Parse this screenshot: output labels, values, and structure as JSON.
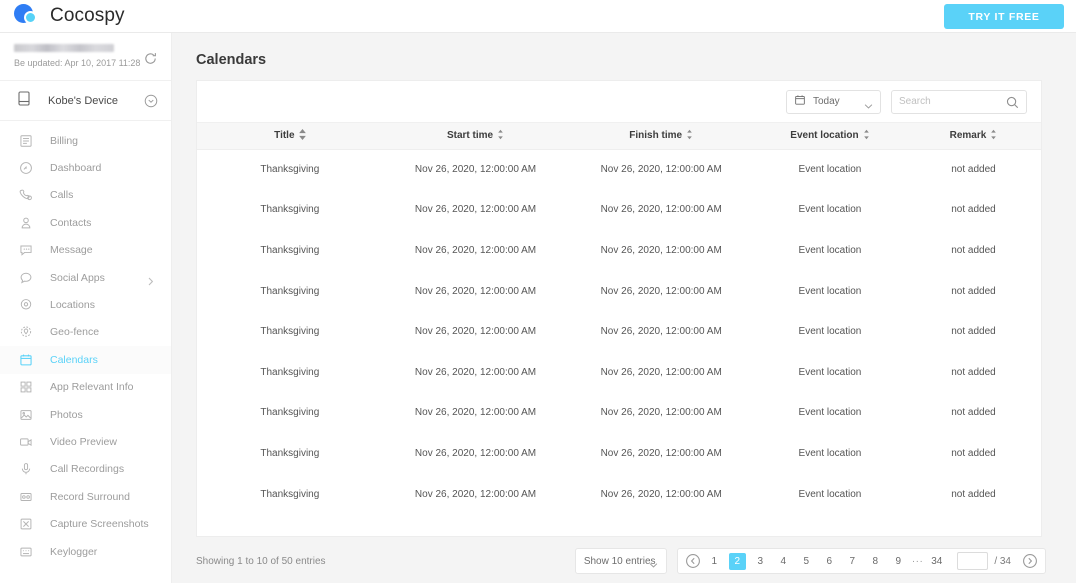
{
  "topbar": {
    "brand_name": "Cocospy",
    "logo_icon": "cocospy-logo",
    "cta_label": "TRY IT FREE",
    "cta_color": "#5ad2f8"
  },
  "sidebar": {
    "account": {
      "email_redacted": "",
      "updated_text": "Be updated: Apr 10, 2017 11:28",
      "refresh_icon": "refresh-icon"
    },
    "device": {
      "icon": "phone-icon",
      "name": "Kobe's Device",
      "caret_icon": "chevron-down-circle-icon"
    },
    "items": [
      {
        "label": "Billing",
        "icon": "billing-icon",
        "active": false
      },
      {
        "label": "Dashboard",
        "icon": "dashboard-icon",
        "active": false
      },
      {
        "label": "Calls",
        "icon": "phone-call-icon",
        "active": false
      },
      {
        "label": "Contacts",
        "icon": "contacts-icon",
        "active": false
      },
      {
        "label": "Message",
        "icon": "message-icon",
        "active": false
      },
      {
        "label": "Social Apps",
        "icon": "social-apps-icon",
        "active": false,
        "expandable": true
      },
      {
        "label": "Locations",
        "icon": "location-pin-icon",
        "active": false
      },
      {
        "label": "Geo-fence",
        "icon": "geofence-icon",
        "active": false
      },
      {
        "label": "Calendars",
        "icon": "calendar-icon",
        "active": true
      },
      {
        "label": "App Relevant Info",
        "icon": "app-grid-icon",
        "active": false
      },
      {
        "label": "Photos",
        "icon": "photo-icon",
        "active": false
      },
      {
        "label": "Video Preview",
        "icon": "video-camera-icon",
        "active": false
      },
      {
        "label": "Call Recordings",
        "icon": "microphone-icon",
        "active": false
      },
      {
        "label": "Record Surround",
        "icon": "record-surround-icon",
        "active": false
      },
      {
        "label": "Capture Screenshots",
        "icon": "screenshot-icon",
        "active": false
      },
      {
        "label": "Keylogger",
        "icon": "keyboard-icon",
        "active": false
      }
    ]
  },
  "main": {
    "page_title": "Calendars",
    "toolbar": {
      "date_filter_label": "Today",
      "date_filter_icon": "calendar-icon",
      "search_placeholder": "Search",
      "search_value": "",
      "search_icon": "search-icon"
    },
    "table": {
      "columns": [
        {
          "label": "Title",
          "sort_icon": "sort-icon"
        },
        {
          "label": "Start time",
          "sort_icon": "sort-icon"
        },
        {
          "label": "Finish time",
          "sort_icon": "sort-icon"
        },
        {
          "label": "Event location",
          "sort_icon": "sort-icon"
        },
        {
          "label": "Remark",
          "sort_icon": "sort-icon"
        }
      ],
      "rows": [
        {
          "title": "Thanksgiving",
          "start": "Nov 26, 2020, 12:00:00 AM",
          "finish": "Nov 26, 2020, 12:00:00 AM",
          "location": "Event location",
          "remark": "not added"
        },
        {
          "title": "Thanksgiving",
          "start": "Nov 26, 2020, 12:00:00 AM",
          "finish": "Nov 26, 2020, 12:00:00 AM",
          "location": "Event location",
          "remark": "not added"
        },
        {
          "title": "Thanksgiving",
          "start": "Nov 26, 2020, 12:00:00 AM",
          "finish": "Nov 26, 2020, 12:00:00 AM",
          "location": "Event location",
          "remark": "not added"
        },
        {
          "title": "Thanksgiving",
          "start": "Nov 26, 2020, 12:00:00 AM",
          "finish": "Nov 26, 2020, 12:00:00 AM",
          "location": "Event location",
          "remark": "not added"
        },
        {
          "title": "Thanksgiving",
          "start": "Nov 26, 2020, 12:00:00 AM",
          "finish": "Nov 26, 2020, 12:00:00 AM",
          "location": "Event location",
          "remark": "not added"
        },
        {
          "title": "Thanksgiving",
          "start": "Nov 26, 2020, 12:00:00 AM",
          "finish": "Nov 26, 2020, 12:00:00 AM",
          "location": "Event location",
          "remark": "not added"
        },
        {
          "title": "Thanksgiving",
          "start": "Nov 26, 2020, 12:00:00 AM",
          "finish": "Nov 26, 2020, 12:00:00 AM",
          "location": "Event location",
          "remark": "not added"
        },
        {
          "title": "Thanksgiving",
          "start": "Nov 26, 2020, 12:00:00 AM",
          "finish": "Nov 26, 2020, 12:00:00 AM",
          "location": "Event location",
          "remark": "not added"
        },
        {
          "title": "Thanksgiving",
          "start": "Nov 26, 2020, 12:00:00 AM",
          "finish": "Nov 26, 2020, 12:00:00 AM",
          "location": "Event location",
          "remark": "not added"
        }
      ]
    },
    "footer": {
      "showing_text": "Showing 1 to 10 of 50 entries",
      "entries_label": "Show 10 entries",
      "prev_icon": "chevron-left-circle-icon",
      "next_icon": "chevron-right-circle-icon",
      "pages": [
        "1",
        "2",
        "3",
        "4",
        "5",
        "6",
        "7",
        "8",
        "9"
      ],
      "active_page": "2",
      "ellipsis": "···",
      "last_page": "34",
      "goto_value": "",
      "total_label": "/ 34",
      "active_color": "#5ad2f8"
    }
  }
}
